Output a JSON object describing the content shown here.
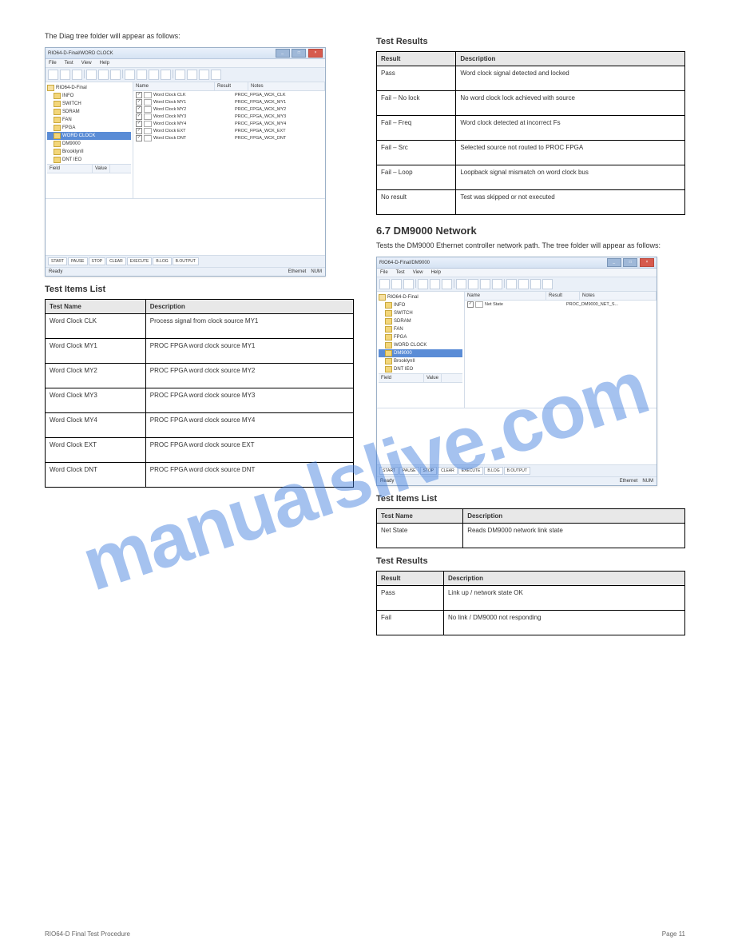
{
  "watermark": "manualslive.com",
  "footer": {
    "left": "RIO64-D Final Test Procedure",
    "right": "Page 11"
  },
  "left_col": {
    "fig1_intro": "The Diag tree folder will appear as follows:",
    "test_items_h": "Test Items List",
    "table1_h1": "Test Name",
    "table1_h2": "Description",
    "table1_rows": [
      [
        "Word Clock CLK",
        "Process signal from clock source MY1"
      ],
      [
        "Word Clock MY1",
        "PROC FPGA word clock source MY1"
      ],
      [
        "Word Clock MY2",
        "PROC FPGA word clock source MY2"
      ],
      [
        "Word Clock MY3",
        "PROC FPGA word clock source MY3"
      ],
      [
        "Word Clock MY4",
        "PROC FPGA word clock source MY4"
      ],
      [
        "Word Clock EXT",
        "PROC FPGA word clock source EXT"
      ],
      [
        "Word Clock DNT",
        "PROC FPGA word clock source DNT"
      ]
    ]
  },
  "right_col": {
    "results_h": "Test Results",
    "table2_h1": "Result",
    "table2_h2": "Description",
    "table2_rows": [
      [
        "Pass",
        "Word clock signal detected and locked"
      ],
      [
        "Fail – No lock",
        "No word clock lock achieved with source"
      ],
      [
        "Fail – Freq",
        "Word clock detected at incorrect Fs"
      ],
      [
        "Fail – Src",
        "Selected source not routed to PROC FPGA"
      ],
      [
        "Fail – Loop",
        "Loopback signal mismatch on word clock bus"
      ],
      [
        "No result",
        "Test was skipped or not executed"
      ]
    ],
    "sec2_h": "6.7  DM9000 Network",
    "sec2_p": "Tests the DM9000 Ethernet controller network path. The tree folder will appear as follows:",
    "sec2_items_h": "Test Items List",
    "t3_h1": "Test Name",
    "t3_h2": "Description",
    "t3_rows": [
      [
        "Net State",
        "Reads DM9000 network link state"
      ]
    ],
    "sec2_results_h": "Test Results",
    "t4_h1": "Result",
    "t4_h2": "Description",
    "t4_rows": [
      [
        "Pass",
        "Link up / network state OK"
      ],
      [
        "Fail",
        "No link / DM9000 not responding"
      ]
    ]
  },
  "shot1": {
    "title": "RIO64-D-Final/WORD CLOCK",
    "menus": [
      "File",
      "Test",
      "View",
      "Help"
    ],
    "cols": [
      "Name",
      "Result",
      "Notes"
    ],
    "fv": [
      "Field",
      "Value"
    ],
    "tree_root": "RIO64-D-Final",
    "tree": [
      "INFO",
      "SWITCH",
      "SDRAM",
      "FAN",
      "FPGA",
      "WORD CLOCK",
      "DM9000",
      "BrooklynII",
      "DNT IEO"
    ],
    "tree_sel": 5,
    "rows": [
      [
        "Word Clock CLK",
        "",
        "PROC_FPGA_WCK_CLK"
      ],
      [
        "Word Clock MY1",
        "",
        "PROC_FPGA_WCK_MY1"
      ],
      [
        "Word Clock MY2",
        "",
        "PROC_FPGA_WCK_MY2"
      ],
      [
        "Word Clock MY3",
        "",
        "PROC_FPGA_WCK_MY3"
      ],
      [
        "Word Clock MY4",
        "",
        "PROC_FPGA_WCK_MY4"
      ],
      [
        "Word Clock EXT",
        "",
        "PROC_FPGA_WCK_EXT"
      ],
      [
        "Word Clock DNT",
        "",
        "PROC_FPGA_WCK_DNT"
      ]
    ],
    "btns": [
      "START",
      "PAUSE",
      "STOP",
      "CLEAR",
      "EXECUTE",
      "B.LOG",
      "B.OUTPUT"
    ],
    "status": "Ready",
    "s2": "Ethernet",
    "s3": "NUM"
  },
  "shot2": {
    "title": "RIO64-D-Final/DM9000",
    "menus": [
      "File",
      "Test",
      "View",
      "Help"
    ],
    "cols": [
      "Name",
      "Result",
      "Notes"
    ],
    "fv": [
      "Field",
      "Value"
    ],
    "tree_root": "RIO64-D-Final",
    "tree": [
      "INFO",
      "SWITCH",
      "SDRAM",
      "FAN",
      "FPGA",
      "WORD CLOCK",
      "DM9000",
      "BrooklynII",
      "DNT IEO"
    ],
    "tree_sel": 6,
    "rows": [
      [
        "Net State",
        "",
        "PROC_DM9000_NET_S..."
      ]
    ],
    "btns": [
      "START",
      "PAUSE",
      "STOP",
      "CLEAR",
      "EXECUTE",
      "B.LOG",
      "B.OUTPUT"
    ],
    "status": "Ready",
    "s2": "Ethernet",
    "s3": "NUM"
  }
}
